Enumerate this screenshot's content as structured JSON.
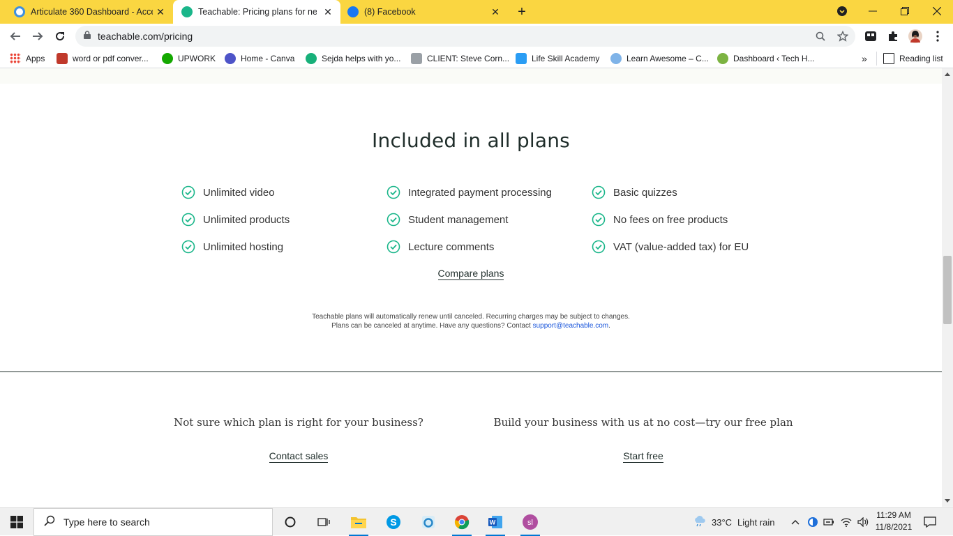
{
  "browser": {
    "tabs": [
      {
        "title": "Articulate 360 Dashboard - Acce",
        "close": "✕"
      },
      {
        "title": "Teachable: Pricing plans for new",
        "close": "✕"
      },
      {
        "title": "(8) Facebook",
        "close": "✕"
      }
    ],
    "new_tab": "+",
    "url": "teachable.com/pricing",
    "bookmarks": [
      {
        "label": "Apps"
      },
      {
        "label": "word or pdf conver..."
      },
      {
        "label": "UPWORK"
      },
      {
        "label": "Home - Canva"
      },
      {
        "label": "Sejda helps with yo..."
      },
      {
        "label": "CLIENT: Steve Corn..."
      },
      {
        "label": "Life Skill Academy"
      },
      {
        "label": "Learn Awesome – C..."
      },
      {
        "label": "Dashboard ‹ Tech H..."
      }
    ],
    "bookmarks_overflow": "»",
    "reading_list": "Reading list"
  },
  "page": {
    "heading": "Included in all plans",
    "features": {
      "col1": [
        "Unlimited video",
        "Unlimited products",
        "Unlimited hosting"
      ],
      "col2": [
        "Integrated payment processing",
        "Student management",
        "Lecture comments"
      ],
      "col3": [
        "Basic quizzes",
        "No fees on free products",
        "VAT (value-added tax) for EU"
      ]
    },
    "compare_link": "Compare plans",
    "fine_print_line1": "Teachable plans will automatically renew until canceled. Recurring charges may be subject to changes.",
    "fine_print_line2_prefix": "Plans can be canceled at anytime. Have any questions? Contact ",
    "fine_print_email": "support@teachable.com",
    "fine_print_line2_suffix": ".",
    "left_question": "Not sure which plan is right for your business?",
    "left_cta": "Contact sales",
    "right_question": "Build your business with us at no cost—try our free plan",
    "right_cta": "Start free"
  },
  "taskbar": {
    "search_placeholder": "Type here to search",
    "weather_temp": "33°C",
    "weather_desc": "Light rain",
    "time": "11:29 AM",
    "date": "11/8/2021"
  },
  "colors": {
    "chrome_frame": "#fad641",
    "check_green": "#1ab68a",
    "link_blue": "#1a56db"
  }
}
